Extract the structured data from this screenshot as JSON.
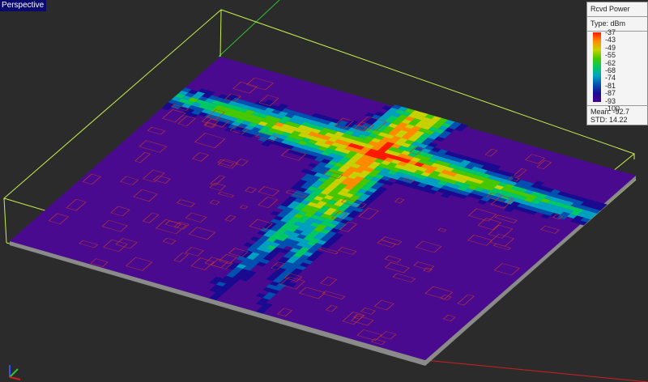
{
  "viewport": {
    "label": "Perspective"
  },
  "legend": {
    "title": "Rcvd Power",
    "type": "Type: dBm",
    "ticks": [
      "-37",
      "-43",
      "-49",
      "-55",
      "-62",
      "-68",
      "-74",
      "-81",
      "-87",
      "-93",
      "-100"
    ],
    "mean": "Mean: -92.7",
    "std": "STD: 14.22"
  },
  "colors": {
    "background": "#2b2b2b",
    "surface": "#4a0a90",
    "box": "#c8f050",
    "buildings": "#c0392b"
  }
}
